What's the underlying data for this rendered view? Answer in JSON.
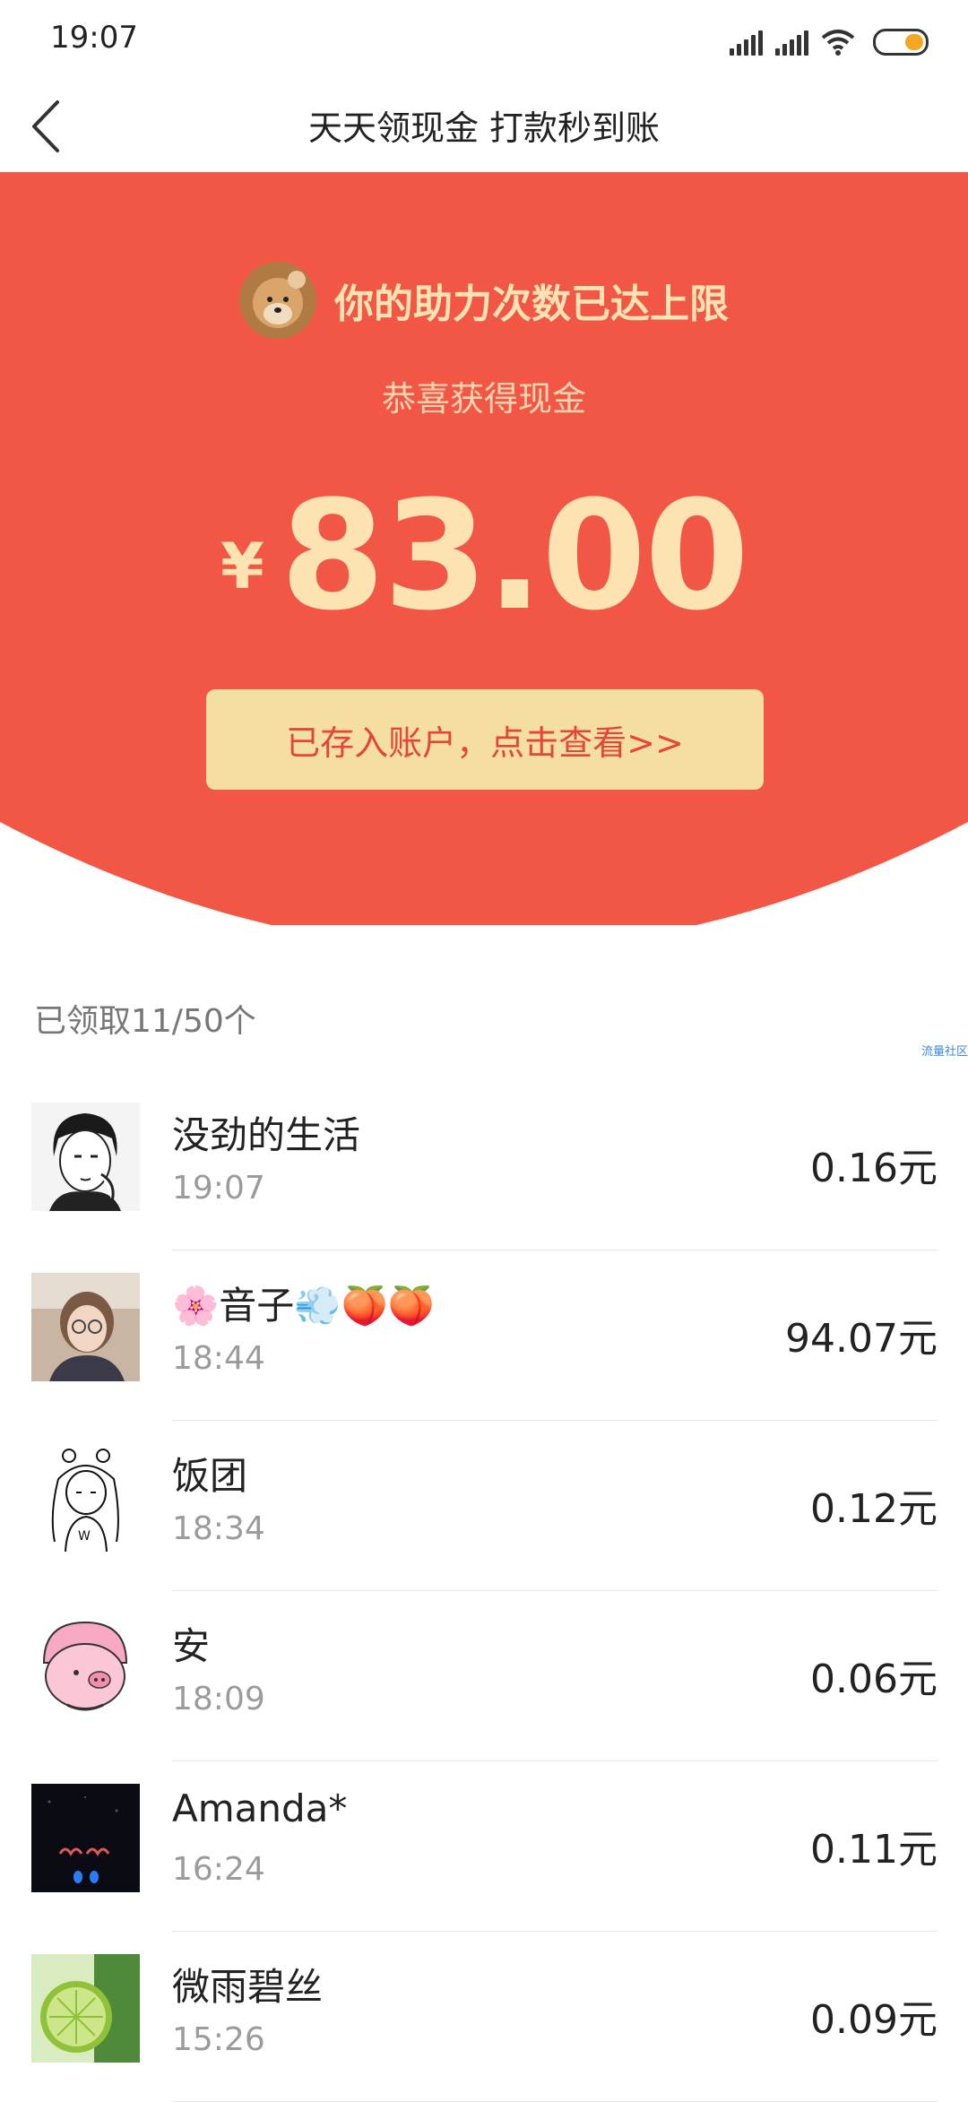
{
  "status_bar": {
    "time": "19:07"
  },
  "nav": {
    "title": "天天领现金 打款秒到账"
  },
  "hero": {
    "limit_text": "你的助力次数已达上限",
    "congrats": "恭喜获得现金",
    "currency": "¥",
    "amount": "83.00",
    "view_button": "已存入账户，点击查看>>"
  },
  "claimed_count": "已领取11/50个",
  "watermark": "流量社区",
  "colors": {
    "hero_red": "#f25746",
    "gold_text": "#fde2b4",
    "button_bg": "#f4dfa0",
    "button_text": "#e5453a"
  },
  "claims": [
    {
      "name": "没劲的生活",
      "time": "19:07",
      "amount": "0.16元",
      "avatar": "manga-boy-avatar"
    },
    {
      "name": "🌸音子💨🍑🍑",
      "time": "18:44",
      "amount": "94.07元",
      "avatar": "woman-glasses-photo"
    },
    {
      "name": "饭团",
      "time": "18:34",
      "amount": "0.12元",
      "avatar": "girl-sketch-avatar"
    },
    {
      "name": "安",
      "time": "18:09",
      "amount": "0.06元",
      "avatar": "pink-pig-avatar"
    },
    {
      "name": "Amanda*",
      "time": "16:24",
      "amount": "0.11元",
      "avatar": "dark-night-photo"
    },
    {
      "name": "微雨碧丝",
      "time": "15:26",
      "amount": "0.09元",
      "avatar": "lime-photo"
    }
  ]
}
